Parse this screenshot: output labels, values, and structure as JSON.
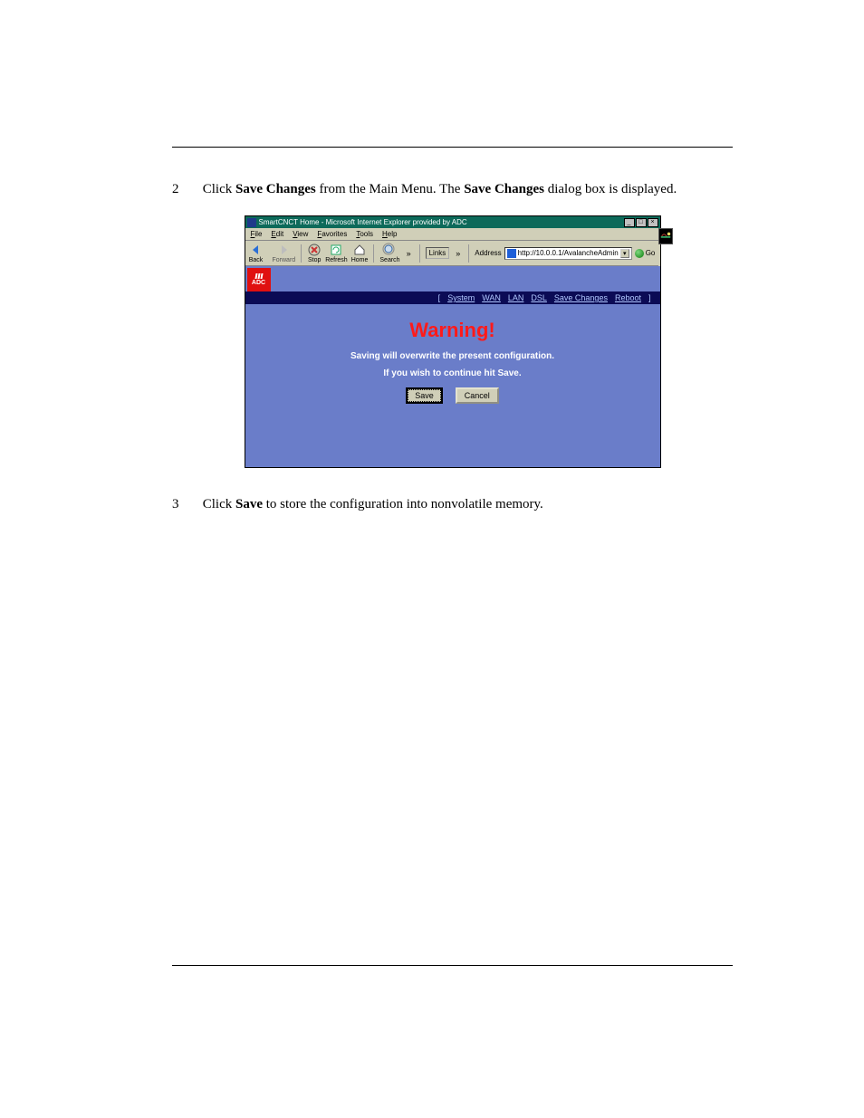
{
  "step2_prefix": "2",
  "step2_a": "Click ",
  "step2_bold1": "Save Changes",
  "step2_b": " from the Main Menu. The ",
  "step2_bold2": "Save Changes",
  "step2_c": " dialog box is displayed.",
  "step3_prefix": "3",
  "step3_a": "Click ",
  "step3_bold": "Save",
  "step3_b": " to store the configuration into nonvolatile memory.",
  "browser": {
    "title": "SmartCNCT Home - Microsoft Internet Explorer provided by ADC",
    "menu": [
      "File",
      "Edit",
      "View",
      "Favorites",
      "Tools",
      "Help"
    ],
    "tb": {
      "back": "Back",
      "forward": "Forward",
      "stop": "Stop",
      "refresh": "Refresh",
      "home": "Home",
      "search": "Search"
    },
    "links_label": "Links",
    "addr_label": "Address",
    "addr_url": "http://10.0.0.1/AvalancheAdmin",
    "go_label": "Go",
    "logo_text": "ADC",
    "nav": {
      "system": "System",
      "wan": "WAN",
      "lan": "LAN",
      "dsl": "DSL",
      "save": "Save Changes",
      "reboot": "Reboot"
    },
    "warning": "Warning!",
    "line1": "Saving will overwrite the present configuration.",
    "line2": "If you wish to continue hit Save.",
    "btn_save": "Save",
    "btn_cancel": "Cancel"
  }
}
